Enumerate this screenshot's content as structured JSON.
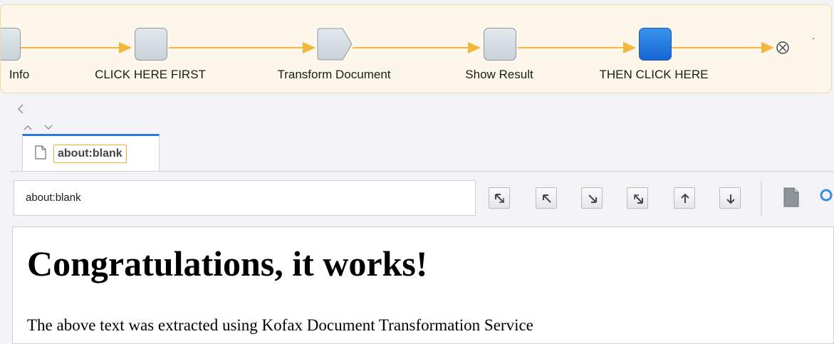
{
  "workflow": {
    "steps": [
      {
        "label": "Info",
        "state": "normal"
      },
      {
        "label": "CLICK HERE FIRST",
        "state": "normal"
      },
      {
        "label": "Transform Document",
        "state": "normal"
      },
      {
        "label": "Show Result",
        "state": "normal"
      },
      {
        "label": "THEN CLICK HERE",
        "state": "active"
      }
    ],
    "end_icon": "end-circle-x-icon",
    "accent_color": "#f3b73a",
    "active_color": "#1f78e0"
  },
  "nav": {
    "back_icon": "chevron-left-icon",
    "up_icon": "chevron-up-icon",
    "down_icon": "chevron-down-icon"
  },
  "tab": {
    "title": "about:blank",
    "icon": "document-icon"
  },
  "address": {
    "value": "about:blank"
  },
  "toolbar": {
    "buttons": [
      "first-icon",
      "previous-icon",
      "next-icon",
      "last-icon",
      "up-icon",
      "down-icon"
    ],
    "page_icon": "page-icon",
    "search_icon": "search-icon"
  },
  "content": {
    "heading": "Congratulations, it works!",
    "text": "The above text was extracted using Kofax Document Transformation Service"
  }
}
